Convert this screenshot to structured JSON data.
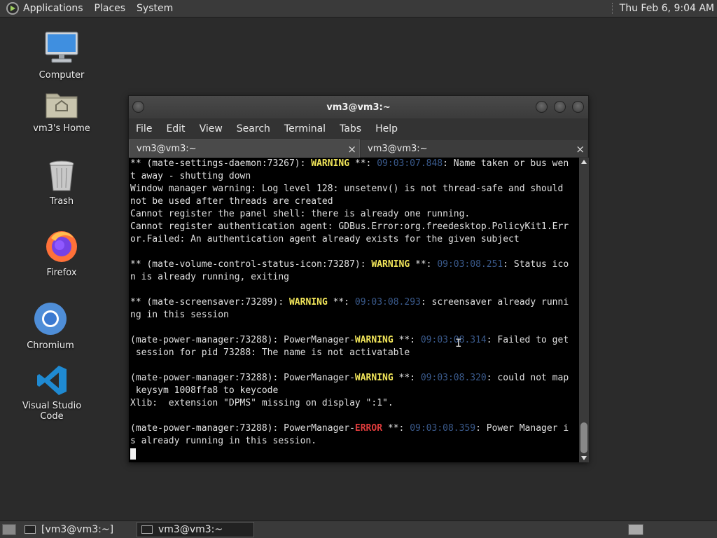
{
  "top_panel": {
    "menus": [
      "Applications",
      "Places",
      "System"
    ],
    "clock": "Thu Feb  6,  9:04 AM"
  },
  "desktop_icons": [
    {
      "label": "Computer",
      "icon": "computer-icon"
    },
    {
      "label": "vm3's Home",
      "icon": "home-folder-icon"
    },
    {
      "label": "Trash",
      "icon": "trash-icon"
    },
    {
      "label": "Firefox",
      "icon": "firefox-icon"
    },
    {
      "label": "Chromium",
      "icon": "chromium-icon"
    },
    {
      "label": "Visual Studio Code",
      "icon": "vscode-icon"
    }
  ],
  "terminal": {
    "title": "vm3@vm3:~",
    "menus": [
      "File",
      "Edit",
      "View",
      "Search",
      "Terminal",
      "Tabs",
      "Help"
    ],
    "tabs": [
      "vm3@vm3:~",
      "vm3@vm3:~"
    ],
    "close_glyph": "×",
    "lines": [
      [
        {
          "t": "** (mate-settings-daemon:73267): "
        },
        {
          "t": "WARNING",
          "c": "warn"
        },
        {
          "t": " **: "
        },
        {
          "t": "09:03:07.848",
          "c": "ts"
        },
        {
          "t": ": Name taken or bus wen"
        }
      ],
      [
        {
          "t": "t away - shutting down"
        }
      ],
      [
        {
          "t": "Window manager warning: Log level 128: unsetenv() is not thread-safe and should"
        }
      ],
      [
        {
          "t": "not be used after threads are created"
        }
      ],
      [
        {
          "t": "Cannot register the panel shell: there is already one running."
        }
      ],
      [
        {
          "t": "Cannot register authentication agent: GDBus.Error:org.freedesktop.PolicyKit1.Err"
        }
      ],
      [
        {
          "t": "or.Failed: An authentication agent already exists for the given subject"
        }
      ],
      [],
      [
        {
          "t": "** (mate-volume-control-status-icon:73287): "
        },
        {
          "t": "WARNING",
          "c": "warn"
        },
        {
          "t": " **: "
        },
        {
          "t": "09:03:08.251",
          "c": "ts"
        },
        {
          "t": ": Status ico"
        }
      ],
      [
        {
          "t": "n is already running, exiting"
        }
      ],
      [],
      [
        {
          "t": "** (mate-screensaver:73289): "
        },
        {
          "t": "WARNING",
          "c": "warn"
        },
        {
          "t": " **: "
        },
        {
          "t": "09:03:08.293",
          "c": "ts"
        },
        {
          "t": ": screensaver already runni"
        }
      ],
      [
        {
          "t": "ng in this session"
        }
      ],
      [],
      [
        {
          "t": "(mate-power-manager:73288): PowerManager-"
        },
        {
          "t": "WARNING",
          "c": "warn"
        },
        {
          "t": " **: "
        },
        {
          "t": "09:03:08.314",
          "c": "ts"
        },
        {
          "t": ": Failed to get"
        }
      ],
      [
        {
          "t": " session for pid 73288: The name is not activatable"
        }
      ],
      [],
      [
        {
          "t": "(mate-power-manager:73288): PowerManager-"
        },
        {
          "t": "WARNING",
          "c": "warn"
        },
        {
          "t": " **: "
        },
        {
          "t": "09:03:08.320",
          "c": "ts"
        },
        {
          "t": ": could not map"
        }
      ],
      [
        {
          "t": " keysym 1008ffa8 to keycode"
        }
      ],
      [
        {
          "t": "Xlib:  extension \"DPMS\" missing on display \":1\"."
        }
      ],
      [],
      [
        {
          "t": "(mate-power-manager:73288): PowerManager-"
        },
        {
          "t": "ERROR",
          "c": "err"
        },
        {
          "t": " **: "
        },
        {
          "t": "09:03:08.359",
          "c": "ts"
        },
        {
          "t": ": Power Manager i"
        }
      ],
      [
        {
          "t": "s already running in this session."
        }
      ]
    ]
  },
  "taskbar": {
    "tasks": [
      "[vm3@vm3:~]",
      "vm3@vm3:~"
    ]
  },
  "colors": {
    "warning": "#f2e65a",
    "error": "#e03c3c",
    "timestamp": "#3a5a8c"
  }
}
